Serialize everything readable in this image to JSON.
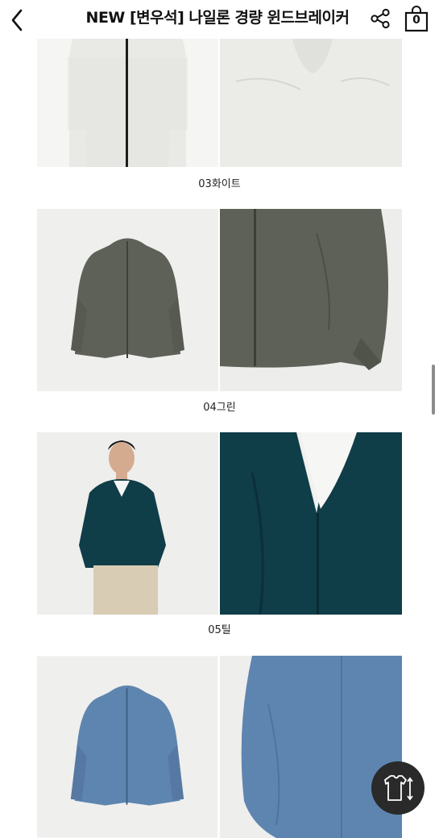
{
  "header": {
    "title": "NEW [변우석] 나일론 경량 윈드브레이커",
    "cart_count": "0"
  },
  "colors": [
    {
      "caption": "03화이트",
      "hex": "#e9e9e6"
    },
    {
      "caption": "04그린",
      "hex": "#5e6157"
    },
    {
      "caption": "05틸",
      "hex": "#0f3d48"
    },
    {
      "caption": "",
      "hex": "#5e85b0"
    }
  ],
  "icons": {
    "back": "chevron-left-icon",
    "share": "share-icon",
    "cart": "shopping-bag-icon",
    "fab": "tshirt-resize-icon"
  }
}
